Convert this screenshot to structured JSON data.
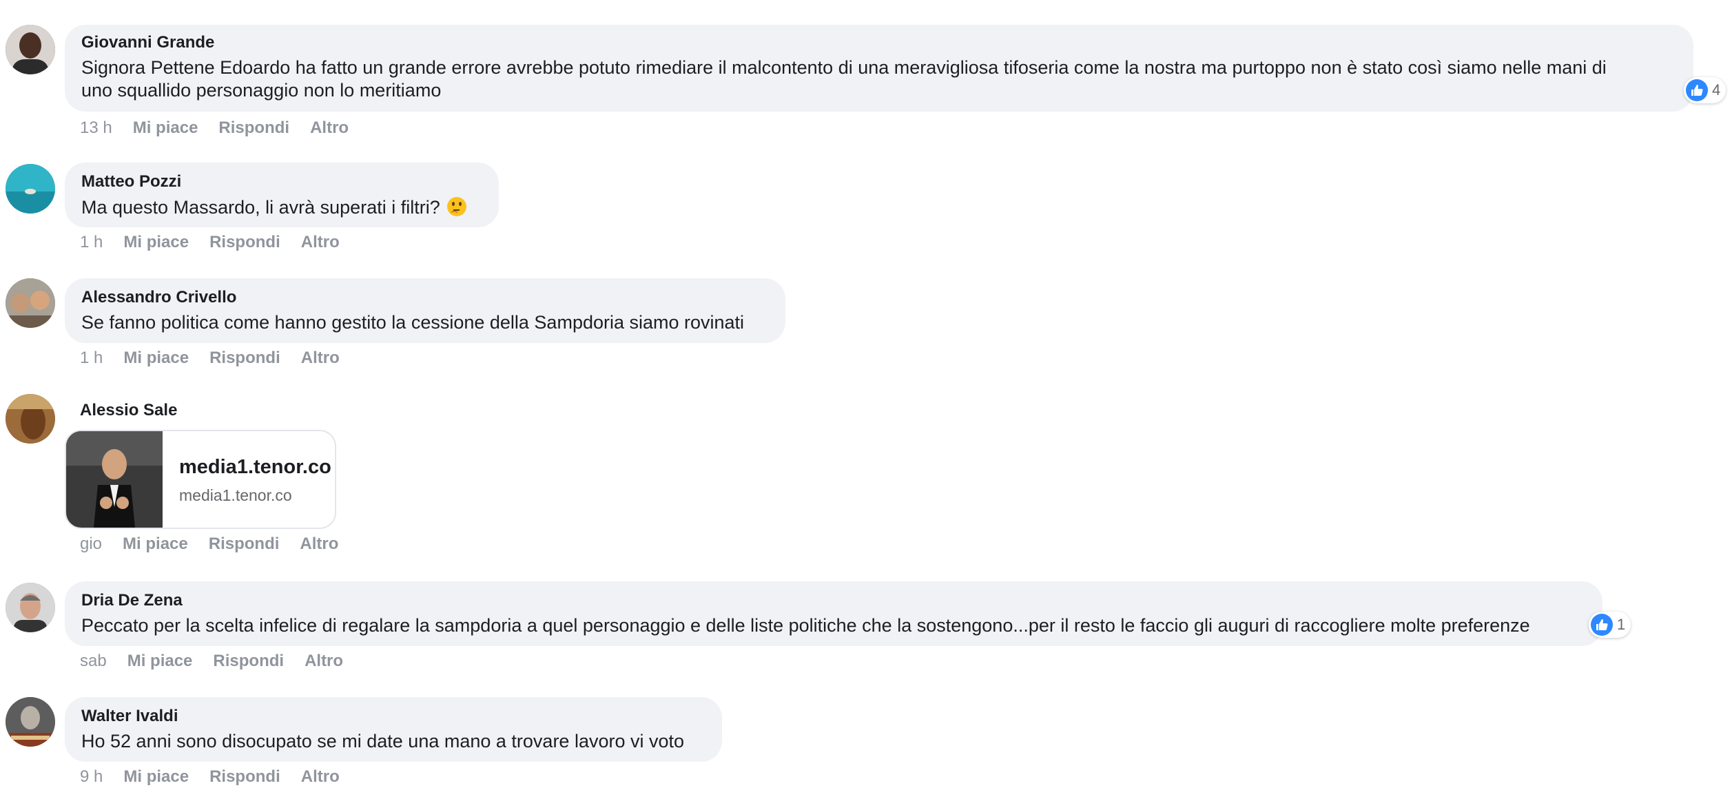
{
  "actions": {
    "like": "Mi piace",
    "reply": "Rispondi",
    "more": "Altro"
  },
  "comments": [
    {
      "author": "Giovanni Grande",
      "text_line1": "Signora Pettene Edoardo ha fatto un grande errore avrebbe potuto rimediare il malcontento di una meravigliosa tifoseria come la nostra ma purtoppo non è stato così siamo nelle mani di",
      "text_line2": "uno squallido personaggio non lo meritiamo",
      "time": "13 h",
      "reactions": "4"
    },
    {
      "author": "Matteo Pozzi",
      "text": "Ma questo Massardo, li avrà superati i filtri?",
      "emoji": "thinking-face",
      "time": "1 h"
    },
    {
      "author": "Alessandro Crivello",
      "text": "Se fanno politica come hanno gestito la cessione della Sampdoria siamo rovinati",
      "time": "1 h"
    },
    {
      "author": "Alessio Sale",
      "link_title": "media1.tenor.co",
      "link_domain": "media1.tenor.co",
      "time": "gio"
    },
    {
      "author": "Dria De Zena",
      "text": "Peccato per la scelta infelice di regalare la sampdoria a quel personaggio e delle liste politiche che la sostengono...per il resto le faccio gli auguri di raccogliere molte preferenze",
      "time": "sab",
      "reactions": "1"
    },
    {
      "author": "Walter Ivaldi",
      "text": "Ho 52 anni sono disocupato se mi date una mano a trovare lavoro vi voto",
      "time": "9 h"
    }
  ],
  "colors": {
    "like": "#2d88ff",
    "bubble": "#f0f2f5",
    "meta": "#90949c"
  }
}
